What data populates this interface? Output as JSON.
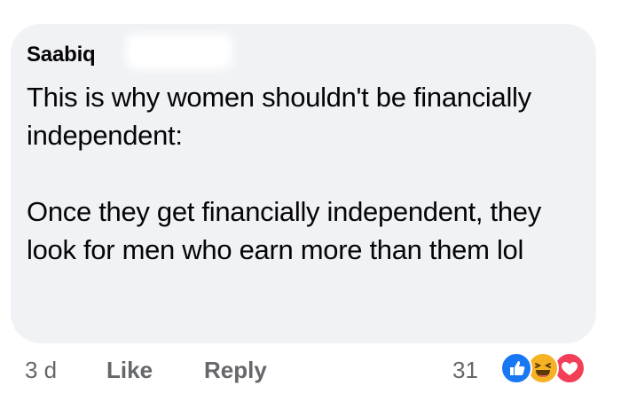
{
  "comment": {
    "author": "Saabiq",
    "paragraphs": [
      "This is why women shouldn't be financially independent:",
      "Once they get financially independent, they look for men who earn more than them lol"
    ]
  },
  "actions": {
    "timestamp": "3 d",
    "like_label": "Like",
    "reply_label": "Reply"
  },
  "reactions": {
    "count": "31",
    "icons": [
      "like-icon",
      "haha-icon",
      "love-icon"
    ]
  },
  "colors": {
    "bubble": "#f0f2f5",
    "text": "#050505",
    "meta": "#65676b",
    "like": "#1877f2",
    "haha": "#f7b125",
    "love": "#f33e58"
  }
}
